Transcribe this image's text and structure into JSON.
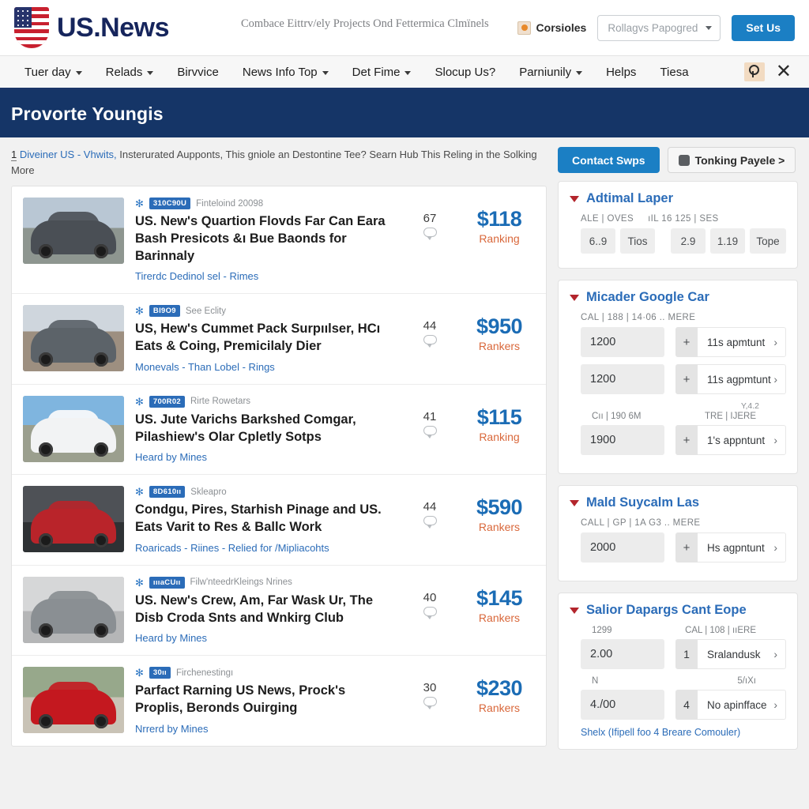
{
  "header": {
    "brand": "US.News",
    "tagline": "Combace Eittrv/ely Projects Ond Fettermica Clmïnels",
    "console_label": "Corsioles",
    "select_value": "Rollagvs Papogred",
    "cta_label": "Set Us"
  },
  "nav": {
    "items": [
      {
        "label": "Tuer day",
        "caret": true
      },
      {
        "label": "Relads",
        "caret": true
      },
      {
        "label": "Birvvice",
        "caret": false
      },
      {
        "label": "News Info Top",
        "caret": true
      },
      {
        "label": "Det Fime",
        "caret": true
      },
      {
        "label": "Slocup Us?",
        "caret": false
      },
      {
        "label": "Parniunily",
        "caret": true
      },
      {
        "label": "Helps",
        "caret": false
      },
      {
        "label": "Tiesa",
        "caret": false
      }
    ],
    "key_icon": "key-icon",
    "close_icon": "close-icon"
  },
  "banner": {
    "title": "Provorte Youngis"
  },
  "breadcrumb": {
    "number": "1",
    "link": "Diveiner US - Vhwits,",
    "rest": "Insterurated Aupponts, This gniole an Destontine Tee?  Searn Hub This Reling in the Solking",
    "more": "More"
  },
  "articles": [
    {
      "pill": "310C90U",
      "tag": "Finteloind 20098",
      "title": "US. New's Quartion Flovds Far Can Eara Bash Presicots &ı Bue Baonds for Barinnaly",
      "sub": "Tirerdc Dedinol sel - Rimes",
      "count": "67",
      "price": "$118",
      "price_label": "Ranking",
      "car_color": "#4a4f55",
      "bg_top": "#b9c7d4",
      "bg_bottom": "#8e9690"
    },
    {
      "pill": "BI9O9",
      "tag": "See Eclity",
      "title": "US, Hew's Cummet Pack Surpıılser, HCı Eats & Coing, Premicilaly Dier",
      "sub": "Monevals - Than Lobel - Rings",
      "count": "44",
      "price": "$950",
      "price_label": "Rankers",
      "car_color": "#5c6369",
      "bg_top": "#cfd6dd",
      "bg_bottom": "#9d8f80"
    },
    {
      "pill": "700R02",
      "tag": "Rirte Rowetars",
      "title": "US. Jute Varichs Barkshed Comgar, Pilashiew's Olar Cpletly Sotps",
      "sub": "Heard by Mines",
      "count": "41",
      "price": "$115",
      "price_label": "Ranking",
      "car_color": "#f2f3f4",
      "bg_top": "#7fb5df",
      "bg_bottom": "#9b9f8e"
    },
    {
      "pill": "8D610ıı",
      "tag": "Skleapro",
      "title": "Condɡu, Pires, Starhish Pinage and US. Eats Varit to Res & Ballc Work",
      "sub": "Roaricads - Riines - Relied for /Mipliacohts",
      "count": "44",
      "price": "$590",
      "price_label": "Rankers",
      "car_color": "#b9242a",
      "bg_top": "#4e5156",
      "bg_bottom": "#2e3134"
    },
    {
      "pill": "ıııaCUıı",
      "tag": "Filw'nteedrKleings Nrines",
      "title": "US. New's Crew, Am, Far Wask Ur, The Disb Croda Snts and Wnkirg Club",
      "sub": "Heard by Mines",
      "count": "40",
      "price": "$145",
      "price_label": "Rankers",
      "car_color": "#8a8f93",
      "bg_top": "#d6d7d8",
      "bg_bottom": "#b5b6b7"
    },
    {
      "pill": "30ıı",
      "tag": "Firchenestingı",
      "title": "Parfact Rarning US News, Prock's Proplis, Beronds Ouirging",
      "sub": "Nrrerd by Mines",
      "count": "30",
      "price": "$230",
      "price_label": "Rankers",
      "car_color": "#c4181f",
      "bg_top": "#97a88b",
      "bg_bottom": "#c9c3b6"
    }
  ],
  "sidebar": {
    "contact_button": "Contact Swps",
    "ghost_button": "Tonking Payele >",
    "cards": [
      {
        "title": "Adtimal Laper",
        "sub_left": "ALE  |  OVES",
        "sub_right": "ıIL  16 125  |  SES",
        "chips": [
          "6..9",
          "Tios",
          "2.9",
          "1.19",
          "Tope"
        ]
      },
      {
        "title": "Micader Google Car",
        "sub1": "CAL  |  188  |  14·06 ..  MERE",
        "rows": [
          {
            "value": "1200",
            "plus": "+",
            "action": "11s apmtunt"
          },
          {
            "value": "1200",
            "plus": "+",
            "action": "11s agpmtunt"
          }
        ],
        "tiny": "Y,4.2",
        "sub2_left": "Cıı |  190  6M",
        "sub2_right": "TRE  |  IJERE",
        "row3": {
          "value": "1900",
          "plus": "+",
          "action": "1's appntunt"
        }
      },
      {
        "title": "Mald Suycalm Las",
        "sub1": "CALL  |  GP  |  1A G3 ..  MERE",
        "rows": [
          {
            "value": "2000",
            "plus": "+",
            "action": "Hs agpntunt"
          }
        ]
      },
      {
        "title": "Salior Dapargs Cant Eope",
        "sub_left": "1299",
        "sub_right": "CAL  |  108  |  ııERE",
        "row1": {
          "value": "2.00",
          "num": "1",
          "action": "Sralandusk"
        },
        "mid_left": "N",
        "mid_right": "5/ıXı",
        "row2": {
          "value": "4./00",
          "num": "4",
          "action": "No apinfface"
        },
        "foot": "Shelx (Ifipell foo 4 Breare Comouler)"
      }
    ]
  }
}
